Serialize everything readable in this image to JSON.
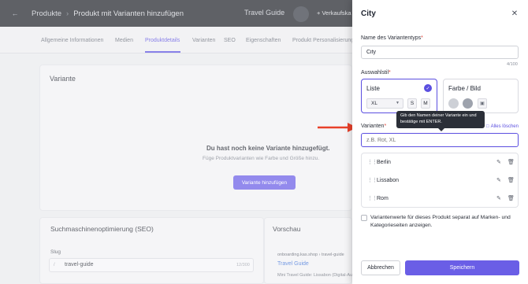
{
  "header": {
    "back_icon": "arrow-left-icon",
    "breadcrumb_root": "Produkte",
    "breadcrumb_sep": "›",
    "breadcrumb_current": "Produkt mit Varianten hinzufügen",
    "store_name": "Travel Guide",
    "sales_label": "+ Verkaufska"
  },
  "tabs": [
    {
      "label": "Allgemeine Informationen"
    },
    {
      "label": "Medien"
    },
    {
      "label": "Produktdetails"
    },
    {
      "label": "Varianten"
    },
    {
      "label": "SEO"
    },
    {
      "label": "Eigenschaften"
    },
    {
      "label": "Produkt Personalisierung"
    }
  ],
  "variants_section": {
    "title": "Variante",
    "empty_title": "Du hast noch keine Variante hinzugefügt.",
    "empty_subtitle": "Füge Produktvarianten wie Farbe und Größe hinzu.",
    "add_button": "Variante hinzufügen"
  },
  "seo_section": {
    "title": "Suchmaschinenoptimierung (SEO)",
    "slug_label": "Slug",
    "slug_prefix": "/",
    "slug_value": "travel-guide",
    "slug_counter": "12/300"
  },
  "preview_section": {
    "title": "Vorschau",
    "url": "onboarding.kas.shop › travel-guide",
    "link": "Travel Guide",
    "description": "Mini Travel Guide: Lissabon (Digital-Ausgabe)"
  },
  "drawer": {
    "title": "City",
    "close_icon": "close-icon",
    "type_name_label": "Name des Variantentyps",
    "required_mark": "*",
    "type_name_value": "City",
    "type_name_counter": "4/100",
    "style_label": "Auswahlstil",
    "style_list": {
      "title": "Liste",
      "check_icon": "check-icon",
      "select_value": "XL",
      "size_s": "S",
      "size_m": "M"
    },
    "style_color": {
      "title": "Farbe / Bild",
      "image_icon": "image-icon"
    },
    "tooltip": "Gib den Namen deiner Variante ein und bestätige mit ENTER.",
    "variants_label": "Varianten",
    "clear_all": "Alles löschen",
    "variants_placeholder": "z.B. Rot, XL",
    "variants": [
      {
        "label": "Berlin"
      },
      {
        "label": "Lissabon"
      },
      {
        "label": "Rom"
      }
    ],
    "separate_checkbox_label": "Variantenwerte für dieses Produkt separat auf Marken- und Kategorieseiten anzeigen.",
    "cancel_button": "Abbrechen",
    "save_button": "Speichern"
  },
  "colors": {
    "accent": "#5b4fe0",
    "button": "#6a5ee6",
    "topbar": "#22252c",
    "annotation_arrow": "#e8402a"
  }
}
